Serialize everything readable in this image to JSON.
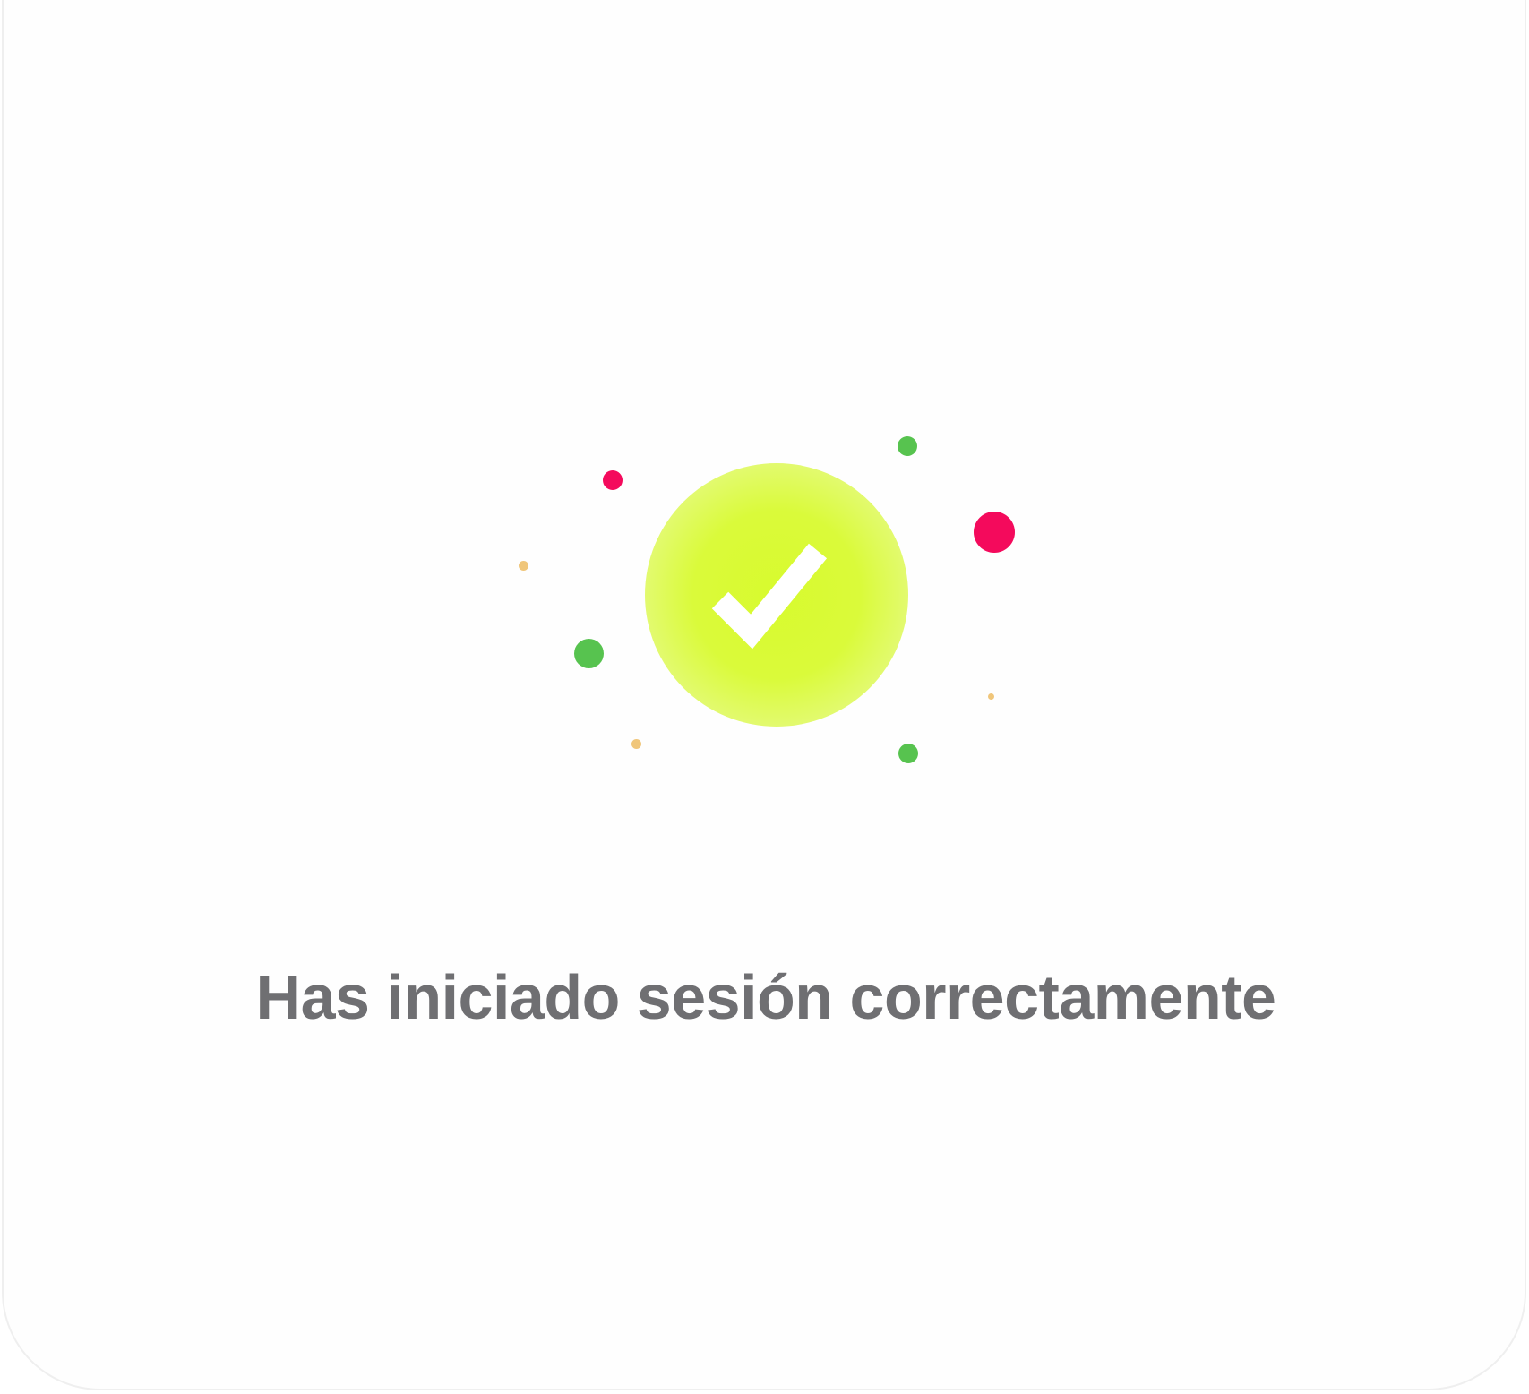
{
  "dialog": {
    "message": "Has iniciado sesión correctamente"
  },
  "illustration": {
    "icon": "check-icon",
    "badge_color": "#d8fb2e",
    "check_color": "#ffffff",
    "confetti_colors": {
      "magenta": "#f40a5c",
      "green": "#57c34f",
      "amber": "#f0c67a"
    }
  }
}
